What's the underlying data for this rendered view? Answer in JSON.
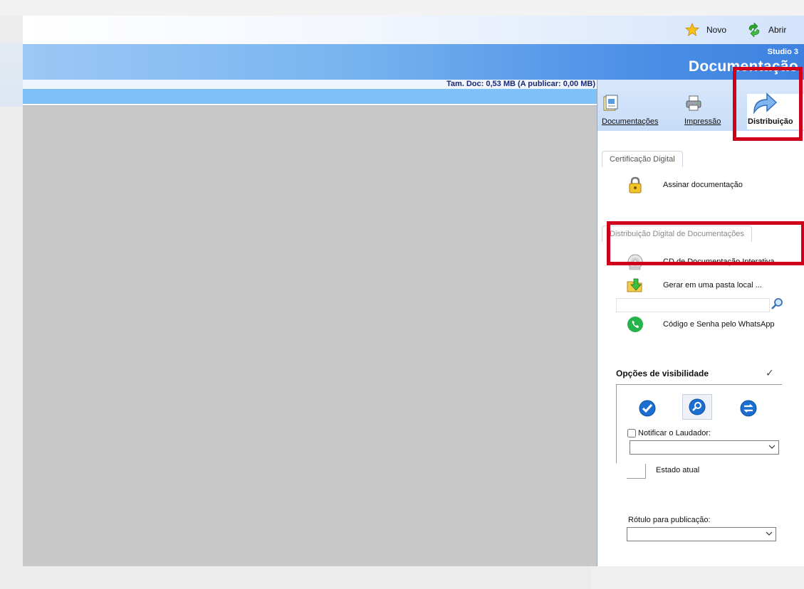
{
  "toolbar": {
    "new_label": "Novo",
    "open_label": "Abrir"
  },
  "banner": {
    "subtitle": "Studio 3",
    "title": "Documentação"
  },
  "status": {
    "doc_size": "Tam. Doc: 0,53 MB (A publicar: 0,00 MB)"
  },
  "tabs": [
    {
      "label": "Documentações",
      "icon": "documents-icon"
    },
    {
      "label": "Impressão",
      "icon": "printer-icon"
    },
    {
      "label": "Distribuição",
      "icon": "share-arrow-icon",
      "active": true
    }
  ],
  "certification": {
    "group_label": "Certificação Digital",
    "sign_label": "Assinar documentação",
    "sign_icon": "padlock-icon"
  },
  "distribution": {
    "group_label": "Distribuição Digital de Documentações",
    "cd_label": "CD de Documentação Interativa ...",
    "cd_icon": "cd-icon",
    "folder_label": "Gerar em uma pasta local ...",
    "folder_icon": "folder-arrow-icon",
    "search_value": "",
    "whatsapp_label": "Código e Senha pelo WhatsApp",
    "whatsapp_icon": "whatsapp-icon"
  },
  "visibility": {
    "title": "Opções de visibilidade",
    "notify_label": "Notificar o Laudador:",
    "notify_checked": false,
    "notify_select_value": "",
    "state_label": "Estado atual",
    "label_caption": "Rótulo para publicação:",
    "label_select_value": ""
  },
  "colors": {
    "banner_start": "#9cc8f4",
    "banner_end": "#3d82e0",
    "highlight_red": "#d0001a",
    "workarea": "#c8c8c8"
  }
}
